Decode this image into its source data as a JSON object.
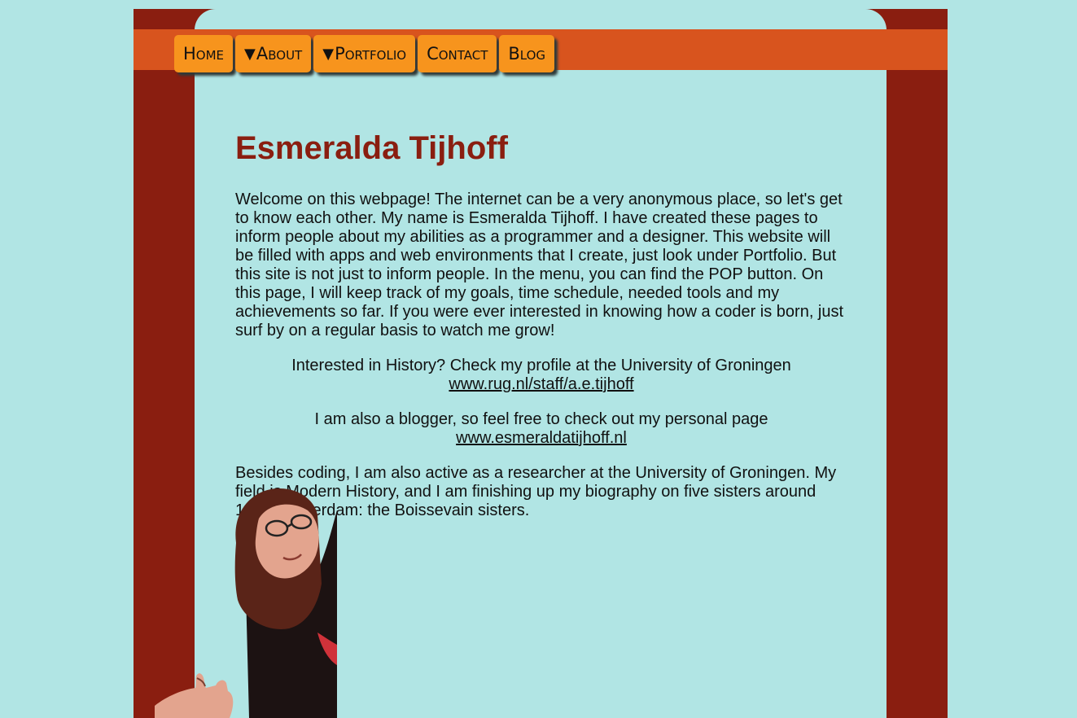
{
  "nav": {
    "items": [
      {
        "label": "Home",
        "caret": ""
      },
      {
        "label": "About",
        "caret": "▼"
      },
      {
        "label": "Portfolio",
        "caret": "▼"
      },
      {
        "label": "Contact",
        "caret": ""
      },
      {
        "label": "Blog",
        "caret": ""
      }
    ]
  },
  "page_title": "Esmeralda Tijhoff",
  "intro": "Welcome on this webpage! The internet can be a very anonymous place, so let's get to know each other. My name is Esmeralda Tijhoff. I have created these pages to inform people about my abilities as a programmer and a designer. This website will be filled with apps and web environments that I create, just look under Portfolio. But this site is not just to inform people. In the menu, you can find the POP button. On this page, I will keep track of my goals, time schedule, needed tools and my achievements so far. If you were ever interested in knowing how a coder is born, just surf by on a regular basis to watch me grow!",
  "history": {
    "text": "Interested in History? Check my profile at the University of Groningen",
    "link": "www.rug.nl/staff/a.e.tijhoff"
  },
  "blog": {
    "text": "I am also a blogger, so feel free to check out my personal page",
    "link": "www.esmeraldatijhoff.nl"
  },
  "research": "Besides coding, I am also active as a researcher at the University of Groningen. My field is Modern History, and I am finishing up my biography on five sisters around 1900 Amsterdam: the Boissevain sisters.",
  "colors": {
    "background": "#b1e5e4",
    "frame": "#8a1e10",
    "nav_band": "#d8541e",
    "nav_button": "#f7941d",
    "title": "#8a1e10"
  }
}
